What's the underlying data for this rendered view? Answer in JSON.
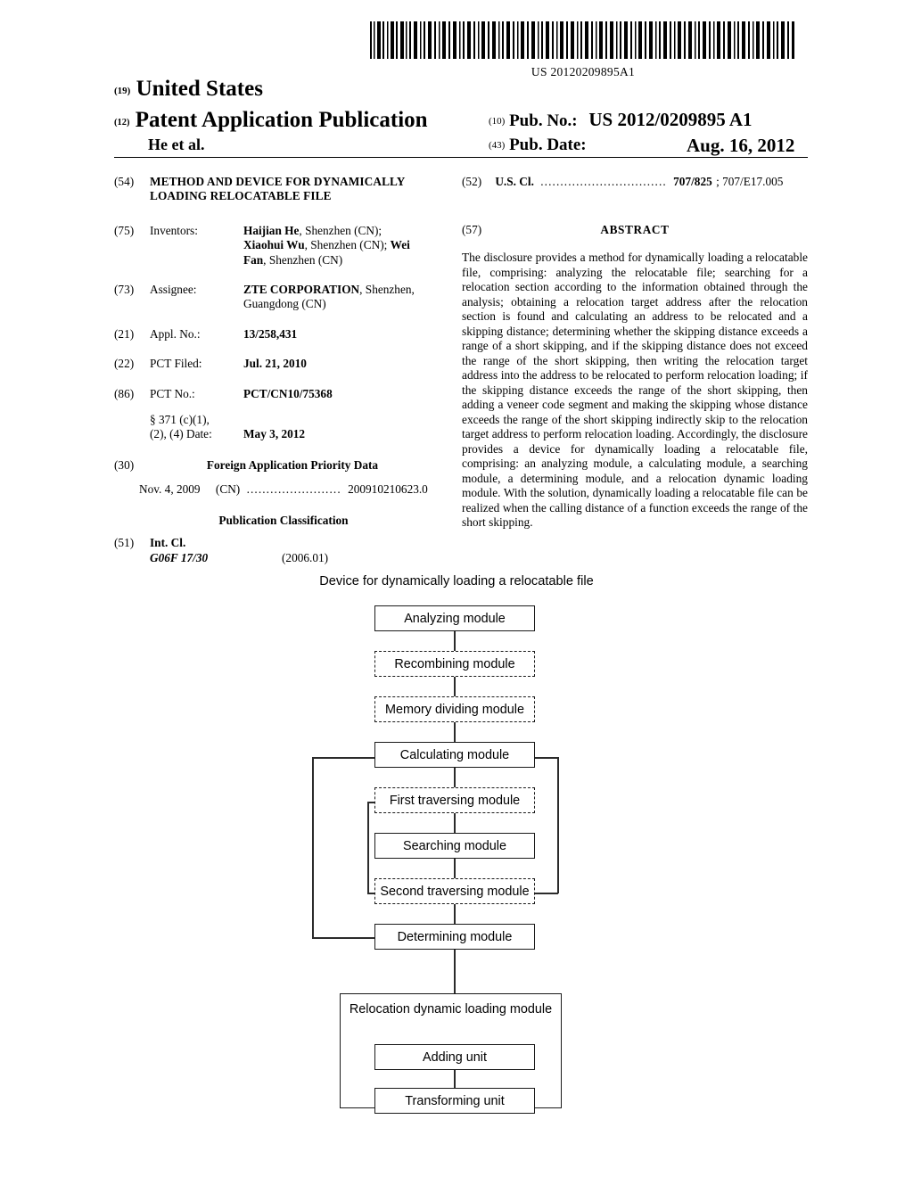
{
  "header": {
    "barcode_number": "US 20120209895A1",
    "country_kind": "(19)",
    "country": "United States",
    "doc_kind": "(12)",
    "doc_type": "Patent Application Publication",
    "applicant_line": "He et al.",
    "pubno_kind": "(10)",
    "pubno_label": "Pub. No.:",
    "pubno_value": "US 2012/0209895 A1",
    "pubdate_kind": "(43)",
    "pubdate_label": "Pub. Date:",
    "pubdate_value": "Aug. 16, 2012"
  },
  "left_column": {
    "title_num": "(54)",
    "title": "METHOD AND DEVICE FOR DYNAMICALLY LOADING RELOCATABLE FILE",
    "inventors_num": "(75)",
    "inventors_label": "Inventors:",
    "inventors_value": "Haijian He, Shenzhen (CN); Xiaohui Wu, Shenzhen (CN); Wei Fan, Shenzhen (CN)",
    "inventors_bold_parts": [
      "Haijian He",
      "Xiaohui Wu",
      "Wei Fan"
    ],
    "assignee_num": "(73)",
    "assignee_label": "Assignee:",
    "assignee_value": "ZTE CORPORATION, Shenzhen, Guangdong (CN)",
    "assignee_bold_part": "ZTE CORPORATION",
    "applno_num": "(21)",
    "applno_label": "Appl. No.:",
    "applno_value": "13/258,431",
    "pctfiled_num": "(22)",
    "pctfiled_label": "PCT Filed:",
    "pctfiled_value": "Jul. 21, 2010",
    "pctno_num": "(86)",
    "pctno_label": "PCT No.:",
    "pctno_value": "PCT/CN10/75368",
    "sec371_line1": "§ 371 (c)(1),",
    "sec371_line2": "(2), (4) Date:",
    "sec371_date": "May 3, 2012",
    "foreign_num": "(30)",
    "foreign_heading": "Foreign Application Priority Data",
    "priority_date": "Nov. 4, 2009",
    "priority_country": "(CN)",
    "priority_dots": "........................",
    "priority_number": "200910210623.0",
    "pubclass_heading": "Publication Classification",
    "intcl_num": "(51)",
    "intcl_label": "Int. Cl.",
    "intcl_code": "G06F  17/30",
    "intcl_version": "(2006.01)"
  },
  "right_column": {
    "uscl_num": "(52)",
    "uscl_label": "U.S. Cl.",
    "uscl_dots": "................................",
    "uscl_primary": "707/825",
    "uscl_secondary": "; 707/E17.005",
    "abstract_num": "(57)",
    "abstract_title": "ABSTRACT",
    "abstract_text": "The disclosure provides a method for dynamically loading a relocatable file, comprising: analyzing the relocatable file; searching for a relocation section according to the information obtained through the analysis; obtaining a relocation target address after the relocation section is found and calculating an address to be relocated and a skipping distance; determining whether the skipping distance exceeds a range of a short skipping, and if the skipping distance does not exceed the range of the short skipping, then writing the relocation target address into the address to be relocated to perform relocation loading; if the skipping distance exceeds the range of the short skipping, then adding a veneer code segment and making the skipping whose distance exceeds the range of the short skipping indirectly skip to the relocation target address to perform relocation loading. Accordingly, the disclosure provides a device for dynamically loading a relocatable file, comprising: an analyzing module, a calculating module, a searching module, a determining module, and a relocation dynamic loading module. With the solution, dynamically loading a relocatable file can be realized when the calling distance of a function exceeds the range of the short skipping."
  },
  "diagram": {
    "title": "Device for dynamically loading a relocatable file",
    "nodes": [
      {
        "id": "analyzing",
        "label": "Analyzing module",
        "style": "solid"
      },
      {
        "id": "recombining",
        "label": "Recombining module",
        "style": "dashed"
      },
      {
        "id": "memory-dividing",
        "label": "Memory dividing module",
        "style": "dashed"
      },
      {
        "id": "calculating",
        "label": "Calculating module",
        "style": "solid"
      },
      {
        "id": "first-traversing",
        "label": "First traversing module",
        "style": "dashed"
      },
      {
        "id": "searching",
        "label": "Searching module",
        "style": "solid"
      },
      {
        "id": "second-traversing",
        "label": "Second traversing module",
        "style": "dashed"
      },
      {
        "id": "determining",
        "label": "Determining module",
        "style": "solid"
      },
      {
        "id": "relocation-dynamic-loading",
        "label": "Relocation dynamic loading module",
        "style": "solid"
      },
      {
        "id": "adding-unit",
        "label": "Adding unit",
        "style": "solid"
      },
      {
        "id": "transforming-unit",
        "label": "Transforming unit",
        "style": "solid"
      }
    ]
  }
}
